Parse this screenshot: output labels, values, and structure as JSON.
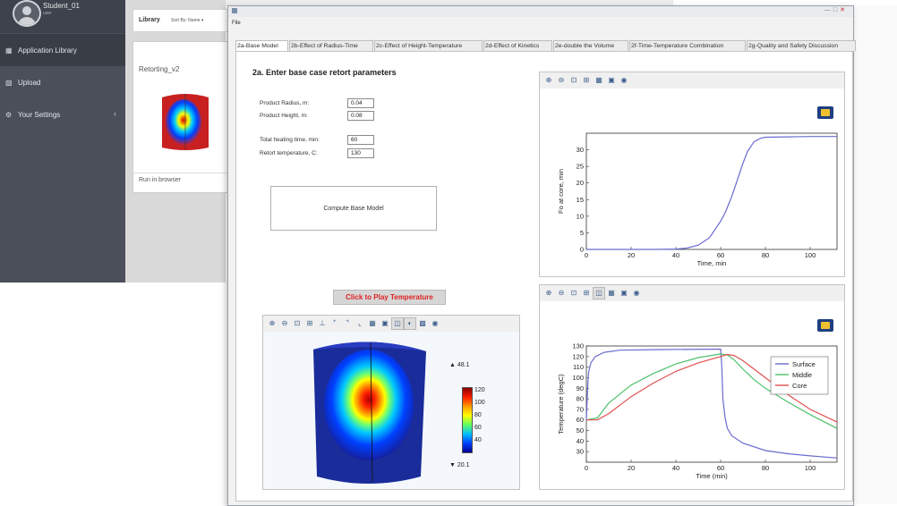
{
  "sidebar": {
    "user_name": "Student_01",
    "user_sub": "user",
    "items": [
      {
        "label": "Application Library",
        "icon": "grid-icon"
      },
      {
        "label": "Upload",
        "icon": "upload-icon"
      },
      {
        "label": "Your Settings",
        "icon": "gear-icon"
      }
    ]
  },
  "library": {
    "title": "Library",
    "sort_label": "Sort By: Name ▾",
    "card_title": "Retorting_v2",
    "card_action": "Run in browser"
  },
  "window": {
    "menu_file": "File",
    "tabs": [
      "2a-Base Model",
      "2b-Effect of Radius-Time",
      "2c-Effect of Height-Temperature",
      "2d-Effect of Kinetics",
      "2e-double the Volume",
      "2f-Time-Temperature Combination",
      "2g-Quality and Safety Discussion"
    ],
    "active_tab": 0
  },
  "form": {
    "title": "2a.  Enter base case retort parameters",
    "radius_label": "Product Radius, m:",
    "radius_value": "0.04",
    "height_label": "Product Height, m:",
    "height_value": "0.08",
    "time_label": "Total heating time, min:",
    "time_value": "60",
    "temp_label": "Retort temperature, C:",
    "temp_value": "130",
    "compute_label": "Compute Base Model",
    "play_label": "Click to Play Temperature"
  },
  "viz": {
    "max_label": "▲ 48.1",
    "min_label": "▼ 20.1",
    "colorbar_ticks": [
      "120",
      "100",
      "80",
      "60",
      "40"
    ]
  },
  "colors": {
    "surface": "#6a6ad0",
    "middle": "#4cc06a",
    "core": "#e05050",
    "fo": "#6a6ad0"
  },
  "chart_data": [
    {
      "type": "line",
      "xlabel": "Time, min",
      "ylabel": "Fo at core, min",
      "xlim": [
        0,
        112
      ],
      "ylim": [
        0,
        35
      ],
      "xticks": [
        0,
        20,
        40,
        60,
        80,
        100
      ],
      "yticks": [
        0,
        5,
        10,
        15,
        20,
        25,
        30
      ],
      "series": [
        {
          "x": [
            0,
            30,
            40,
            45,
            50,
            55,
            60,
            62,
            65,
            68,
            70,
            72,
            75,
            78,
            80,
            90,
            100,
            112
          ],
          "y": [
            0,
            0,
            0.1,
            0.4,
            1.3,
            3.5,
            8.5,
            11,
            16,
            22,
            26,
            29.5,
            32.5,
            33.5,
            33.8,
            33.9,
            34,
            34
          ]
        }
      ]
    },
    {
      "type": "line",
      "xlabel": "Time (min)",
      "ylabel": "Temperature (degC)",
      "xlim": [
        0,
        112
      ],
      "ylim": [
        20,
        130
      ],
      "xticks": [
        0,
        20,
        40,
        60,
        80,
        100
      ],
      "yticks": [
        30,
        40,
        50,
        60,
        70,
        80,
        90,
        100,
        110,
        120,
        130
      ],
      "series": [
        {
          "name": "Surface",
          "x": [
            0,
            0.5,
            1,
            2,
            4,
            8,
            15,
            30,
            60,
            60.5,
            61,
            62,
            63,
            65,
            70,
            80,
            90,
            100,
            112
          ],
          "y": [
            60,
            88,
            105,
            114,
            120,
            124,
            126,
            126.5,
            127,
            110,
            80,
            62,
            52,
            45,
            38,
            31,
            28,
            26,
            24
          ]
        },
        {
          "name": "Middle",
          "x": [
            0,
            5,
            10,
            20,
            30,
            40,
            50,
            60,
            63,
            66,
            70,
            75,
            80,
            90,
            100,
            112
          ],
          "y": [
            60,
            62,
            76,
            93,
            104,
            113,
            119,
            122.5,
            121.5,
            117,
            108,
            98,
            90,
            77,
            65,
            52
          ]
        },
        {
          "name": "Core",
          "x": [
            0,
            5,
            10,
            20,
            30,
            40,
            50,
            60,
            63,
            66,
            70,
            75,
            80,
            90,
            100,
            112
          ],
          "y": [
            60,
            60,
            66,
            82,
            95,
            106,
            114,
            120,
            122,
            121,
            116,
            108,
            100,
            84,
            70,
            58
          ]
        }
      ]
    }
  ]
}
